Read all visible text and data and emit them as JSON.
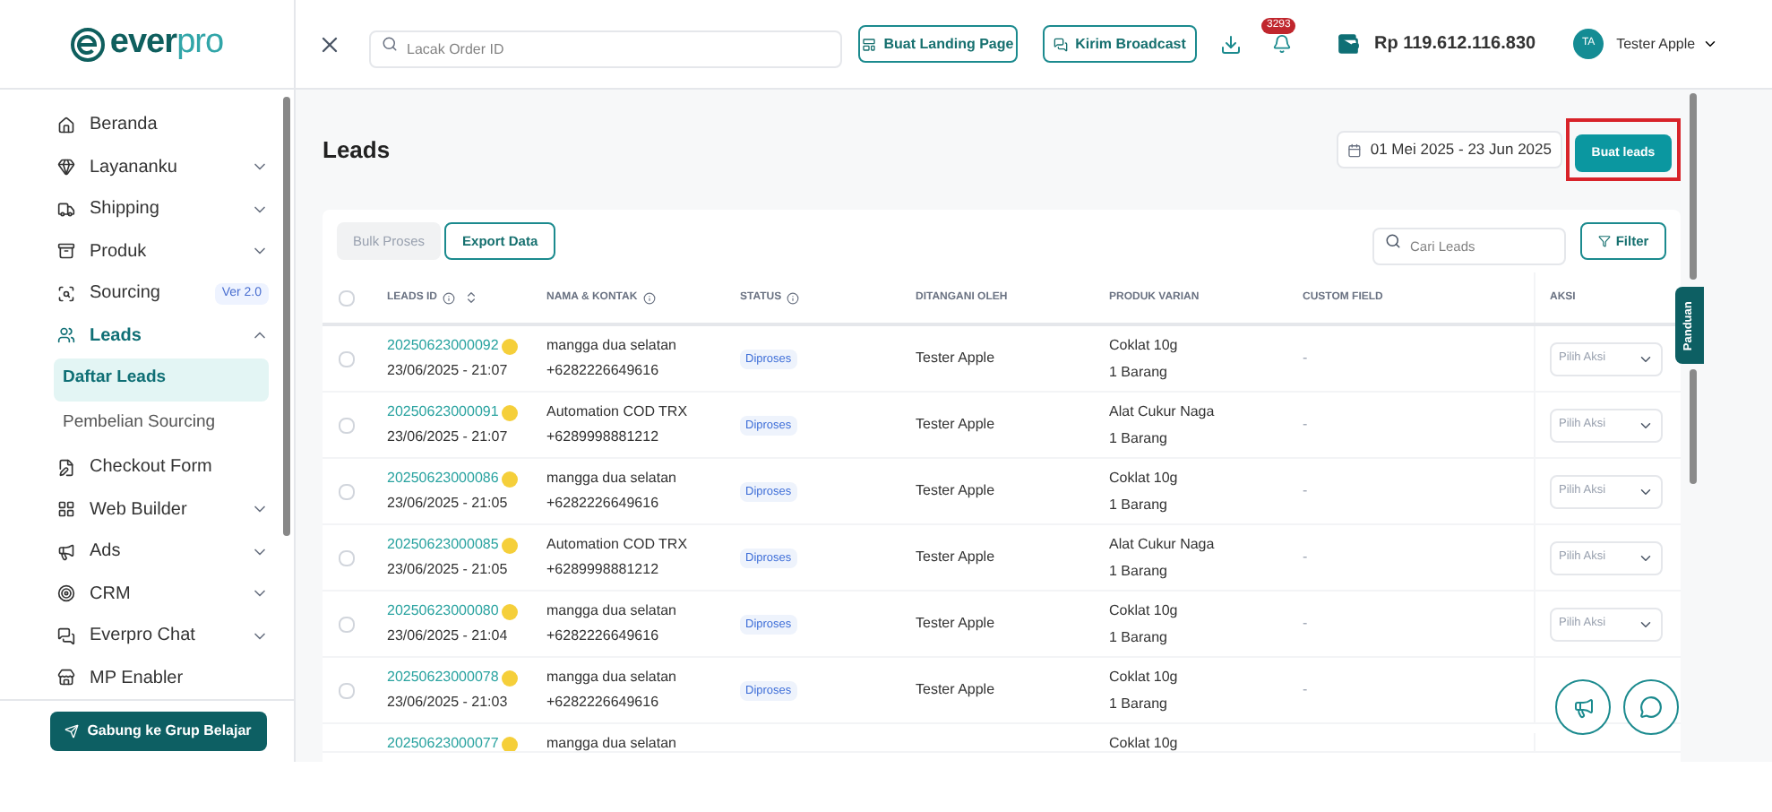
{
  "logo": {
    "part_1": "ever",
    "part_2": "pro"
  },
  "header": {
    "search": {
      "placeholder": "Lacak Order ID"
    },
    "buttons": [
      "Buat Landing Page",
      "Kirim Broadcast"
    ],
    "notification_count": "3293",
    "balance": "Rp 119.612.116.830",
    "user": {
      "initials": "TA",
      "name": "Tester Apple"
    }
  },
  "sidebar": {
    "items": [
      {
        "label": "Beranda",
        "kind": "link",
        "selected": false
      },
      {
        "label": "Layananku",
        "kind": "group",
        "selected": false,
        "expanded": false
      },
      {
        "label": "Shipping",
        "kind": "group",
        "selected": false,
        "expanded": false
      },
      {
        "label": "Produk",
        "kind": "group",
        "selected": false,
        "expanded": false
      },
      {
        "label": "Sourcing",
        "kind": "badge",
        "selected": false,
        "badge": "Ver 2.0"
      },
      {
        "label": "Leads",
        "kind": "group",
        "selected": true,
        "expanded": true,
        "children": [
          {
            "label": "Daftar Leads",
            "selected": true
          },
          {
            "label": "Pembelian Sourcing",
            "selected": false
          }
        ]
      },
      {
        "label": "Checkout Form",
        "kind": "link",
        "selected": false
      },
      {
        "label": "Web Builder",
        "kind": "group",
        "selected": false,
        "expanded": false
      },
      {
        "label": "Ads",
        "kind": "group",
        "selected": false,
        "expanded": false
      },
      {
        "label": "CRM",
        "kind": "group",
        "selected": false,
        "expanded": false
      },
      {
        "label": "Everpro Chat",
        "kind": "group",
        "selected": false,
        "expanded": false
      },
      {
        "label": "MP Enabler",
        "kind": "link",
        "selected": false
      }
    ],
    "join_button": "Gabung ke Grup Belajar"
  },
  "page": {
    "title": "Leads",
    "date_range": "01 Mei 2025 - 23 Jun 2025",
    "create_button": {
      "label": "Buat leads",
      "highlighted": true
    }
  },
  "toolbar": {
    "tabs": [
      {
        "label": "Bulk Proses",
        "selected": false
      },
      {
        "label": "Export Data",
        "selected": true
      }
    ],
    "search": {
      "placeholder": "Cari Leads"
    },
    "filter": "Filter"
  },
  "table": {
    "select_all_checked": false,
    "columns": [
      {
        "label": "LEADS ID",
        "info": true,
        "sortable": true
      },
      {
        "label": "NAMA & KONTAK",
        "info": true,
        "sortable": false
      },
      {
        "label": "STATUS",
        "info": true,
        "sortable": false
      },
      {
        "label": "DITANGANI OLEH",
        "info": false,
        "sortable": false
      },
      {
        "label": "PRODUK VARIAN",
        "info": false,
        "sortable": false
      },
      {
        "label": "CUSTOM FIELD",
        "info": false,
        "sortable": false
      },
      {
        "label": "AKSI",
        "info": false,
        "sortable": false
      }
    ],
    "rows": [
      {
        "checked": false,
        "id": "20250623000092",
        "time": "23/06/2025 - 21:07",
        "name": "mangga dua selatan",
        "phone": "+6282226649616",
        "status": "Diproses",
        "handler": "Tester Apple",
        "product": "Coklat 10g",
        "qty": "1 Barang",
        "custom": "-",
        "action": "Pilih Aksi"
      },
      {
        "checked": false,
        "id": "20250623000091",
        "time": "23/06/2025 - 21:07",
        "name": "Automation COD TRX",
        "phone": "+6289998881212",
        "status": "Diproses",
        "handler": "Tester Apple",
        "product": "Alat Cukur Naga",
        "qty": "1 Barang",
        "custom": "-",
        "action": "Pilih Aksi"
      },
      {
        "checked": false,
        "id": "20250623000086",
        "time": "23/06/2025 - 21:05",
        "name": "mangga dua selatan",
        "phone": "+6282226649616",
        "status": "Diproses",
        "handler": "Tester Apple",
        "product": "Coklat 10g",
        "qty": "1 Barang",
        "custom": "-",
        "action": "Pilih Aksi"
      },
      {
        "checked": false,
        "id": "20250623000085",
        "time": "23/06/2025 - 21:05",
        "name": "Automation COD TRX",
        "phone": "+6289998881212",
        "status": "Diproses",
        "handler": "Tester Apple",
        "product": "Alat Cukur Naga",
        "qty": "1 Barang",
        "custom": "-",
        "action": "Pilih Aksi"
      },
      {
        "checked": false,
        "id": "20250623000080",
        "time": "23/06/2025 - 21:04",
        "name": "mangga dua selatan",
        "phone": "+6282226649616",
        "status": "Diproses",
        "handler": "Tester Apple",
        "product": "Coklat 10g",
        "qty": "1 Barang",
        "custom": "-",
        "action": "Pilih Aksi"
      },
      {
        "checked": false,
        "id": "20250623000078",
        "time": "23/06/2025 - 21:03",
        "name": "mangga dua selatan",
        "phone": "+6282226649616",
        "status": "Diproses",
        "handler": "Tester Apple",
        "product": "Coklat 10g",
        "qty": "1 Barang",
        "custom": "-"
      },
      {
        "id": "20250623000077",
        "name": "mangga dua selatan",
        "product": "Coklat 10g"
      }
    ]
  },
  "guide_tab": "Panduan"
}
